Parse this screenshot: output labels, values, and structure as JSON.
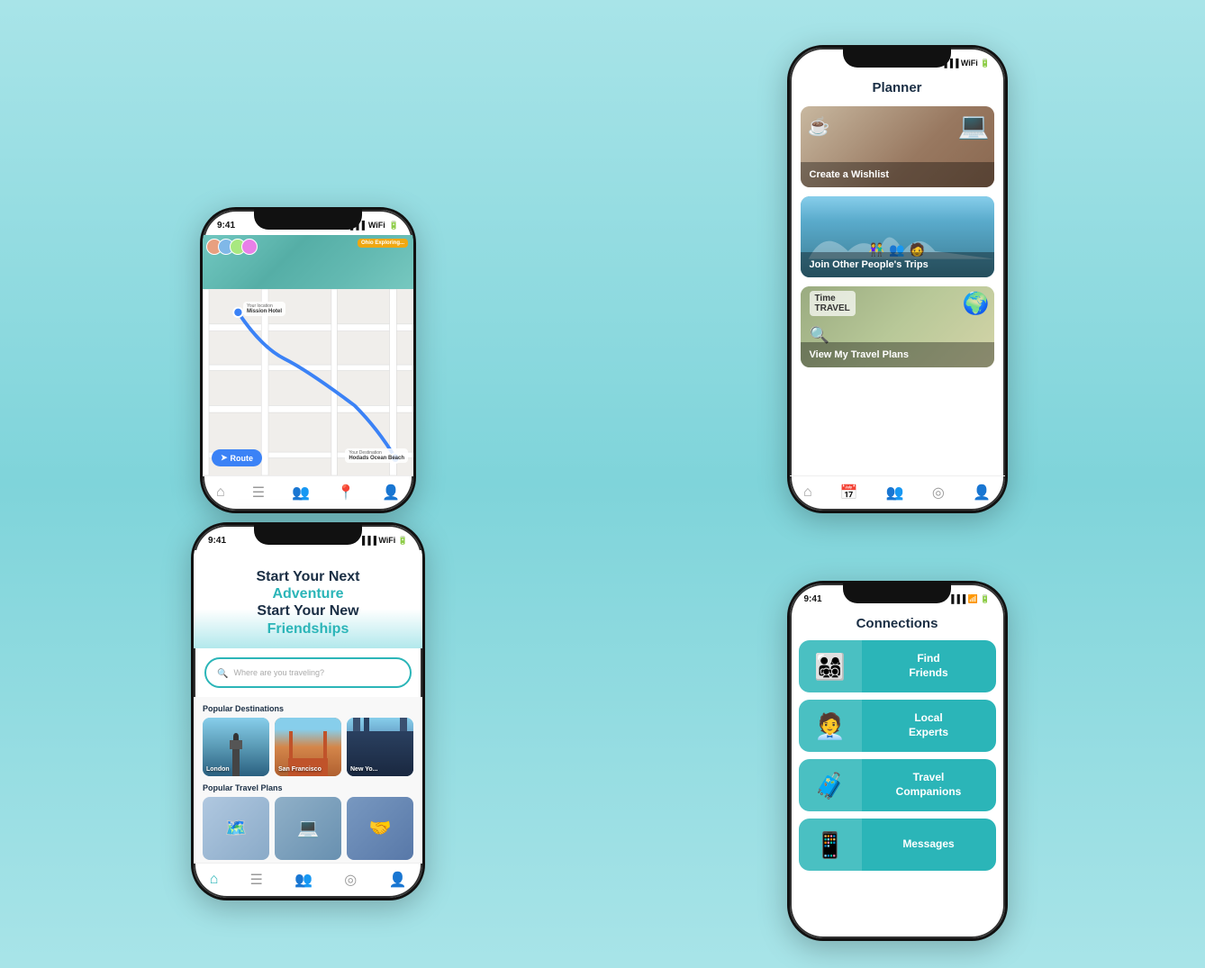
{
  "phones": {
    "map": {
      "status_time": "9:41",
      "location_label": "Your location",
      "location_name": "Mission Hotel",
      "destination_label": "Your Destination",
      "destination_name": "Hodads Ocean Beach",
      "route_btn": "Route",
      "nav": [
        "home",
        "calendar",
        "group",
        "pin-active",
        "person"
      ]
    },
    "home": {
      "status_time": "9:41",
      "headline1": "Start Your Next",
      "headline2": "Adventure",
      "headline3": "Start Your New",
      "headline4": "Friendships",
      "search_placeholder": "Where are you traveling?",
      "popular_destinations_label": "Popular Destinations",
      "destinations": [
        {
          "name": "London",
          "bg": "london"
        },
        {
          "name": "San Francisco",
          "bg": "sf"
        },
        {
          "name": "New Yo...",
          "bg": "ny"
        }
      ],
      "popular_plans_label": "Popular Travel Plans",
      "plans": [
        {
          "bg": "plan1"
        },
        {
          "bg": "plan2"
        },
        {
          "bg": "plan3"
        }
      ],
      "nav": [
        "home-active",
        "calendar",
        "group",
        "pin",
        "person"
      ]
    },
    "planner": {
      "status_time": "",
      "title": "Planner",
      "cards": [
        {
          "label": "Create a Wishlist",
          "bg": "wishlist"
        },
        {
          "label": "Join Other People's Trips",
          "bg": "trips"
        },
        {
          "label": "View My Travel Plans",
          "bg": "plans"
        }
      ],
      "nav": [
        "home",
        "calendar-active",
        "group",
        "pin",
        "person"
      ]
    },
    "connections": {
      "status_time": "9:41",
      "title": "Connections",
      "items": [
        {
          "label": "Find\nFriends"
        },
        {
          "label": "Local\nExperts"
        },
        {
          "label": "Travel\nCompanions"
        },
        {
          "label": "Messages"
        }
      ],
      "nav": [
        "home",
        "calendar",
        "group",
        "pin",
        "person"
      ]
    }
  }
}
